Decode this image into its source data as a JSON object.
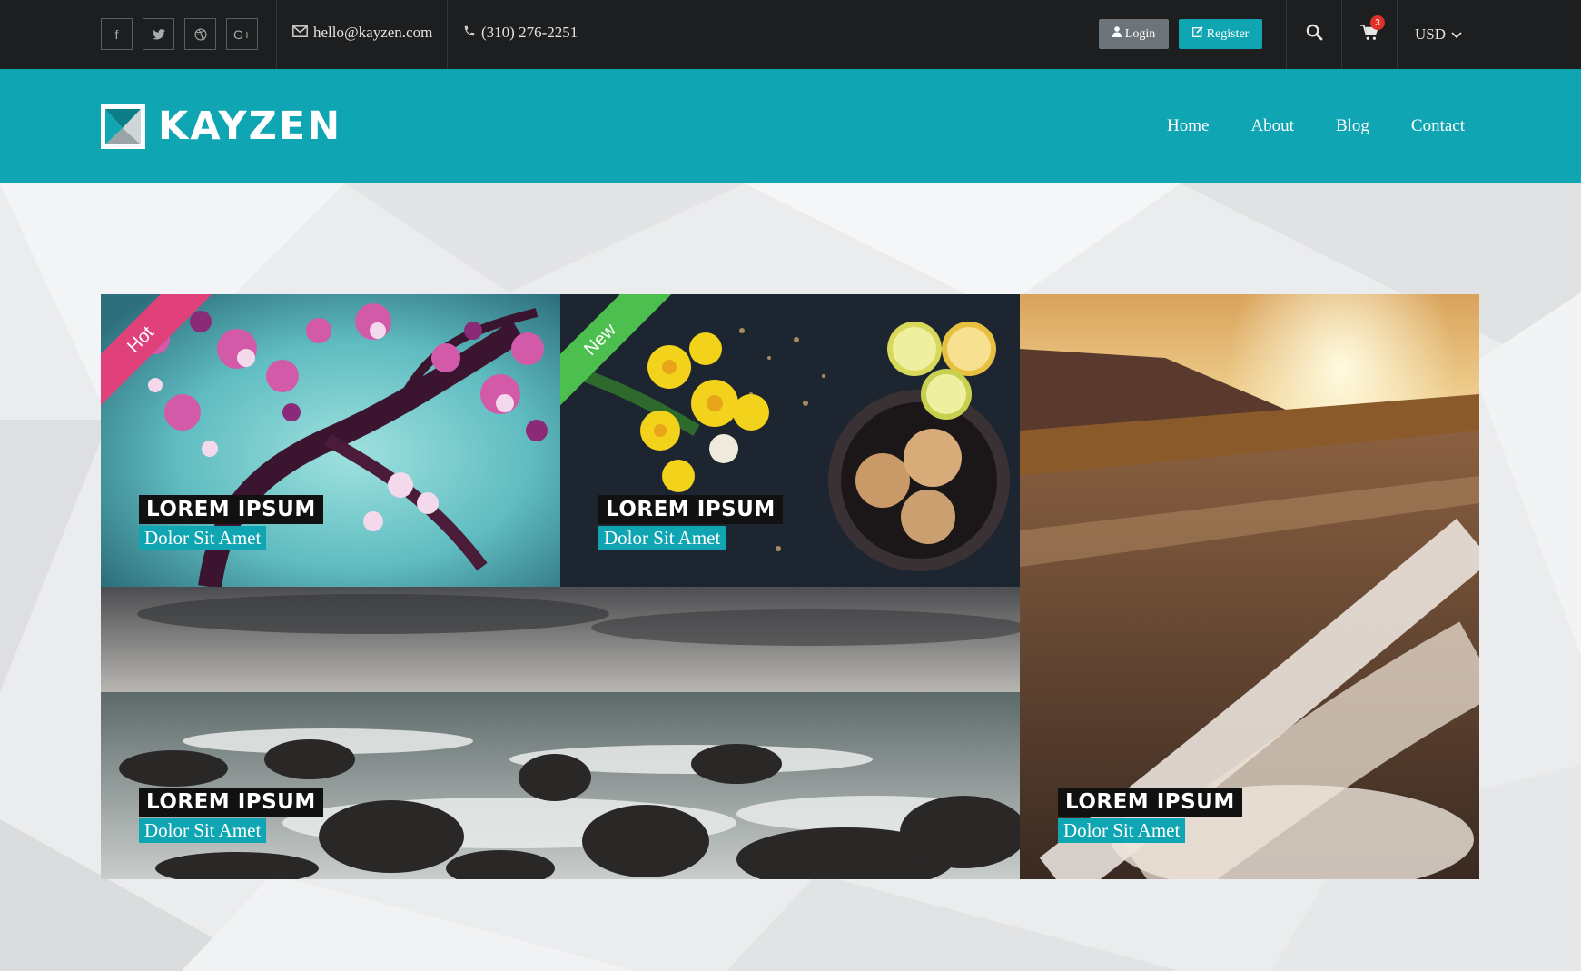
{
  "topbar": {
    "social": [
      {
        "name": "facebook",
        "glyph": "f"
      },
      {
        "name": "twitter",
        "glyph": "🐦"
      },
      {
        "name": "dribbble",
        "glyph": "⊛"
      },
      {
        "name": "google-plus",
        "glyph": "G+"
      }
    ],
    "email": "hello@kayzen.com",
    "phone": "(310) 276-2251",
    "login_label": "Login",
    "register_label": "Register",
    "cart_count": "3",
    "currency": "USD"
  },
  "header": {
    "logo_text": "KAYZEN",
    "nav": [
      "Home",
      "About",
      "Blog",
      "Contact"
    ]
  },
  "tiles": [
    {
      "title": "LOREM IPSUM",
      "subtitle": "Dolor Sit Amet",
      "ribbon": "Hot"
    },
    {
      "title": "LOREM IPSUM",
      "subtitle": "Dolor Sit Amet",
      "ribbon": "New"
    },
    {
      "title": "LOREM IPSUM",
      "subtitle": "Dolor Sit Amet"
    },
    {
      "title": "LOREM IPSUM",
      "subtitle": "Dolor Sit Amet"
    }
  ],
  "colors": {
    "accent": "#0fa5b2",
    "topbar": "#1c1e1f",
    "hot": "#e0417a",
    "new": "#4dbf4f",
    "badge": "#e0302a"
  }
}
